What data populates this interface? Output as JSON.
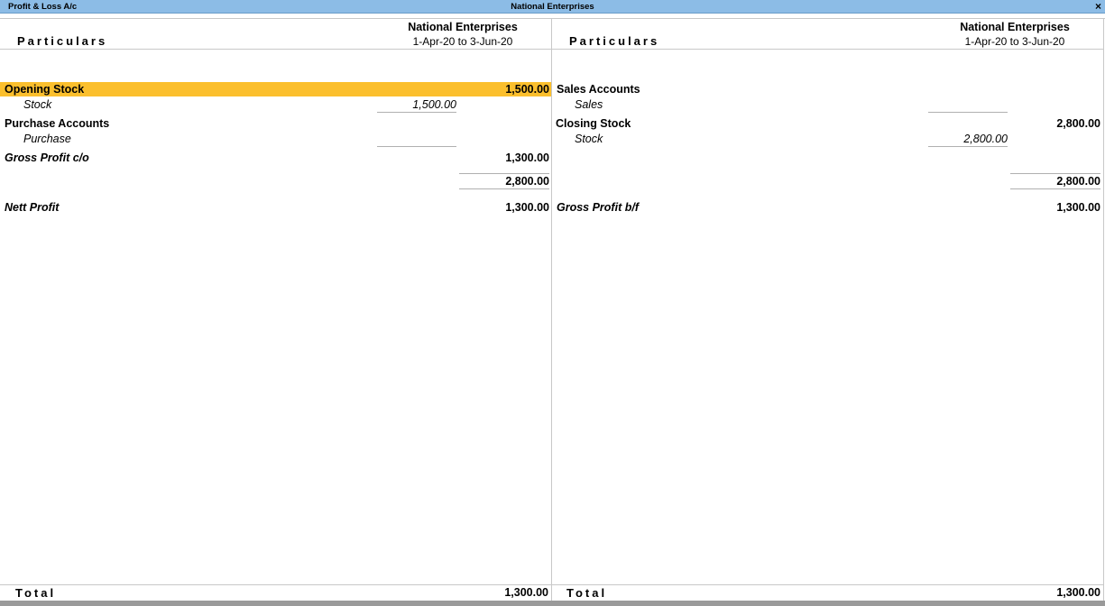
{
  "window": {
    "title": "Profit & Loss A/c",
    "company_title": "National Enterprises",
    "close_label": "×"
  },
  "columns": {
    "particulars": "Particulars",
    "company": "National Enterprises",
    "period": "1-Apr-20 to 3-Jun-20"
  },
  "left": {
    "opening_stock": {
      "label": "Opening Stock",
      "amount": "1,500.00"
    },
    "opening_stock_item": {
      "label": "Stock",
      "amount": "1,500.00"
    },
    "purchase_accounts": {
      "label": "Purchase Accounts"
    },
    "purchase_item": {
      "label": "Purchase"
    },
    "gross_profit_co": {
      "label": "Gross Profit c/o",
      "amount": "1,300.00"
    },
    "subtotal": "2,800.00",
    "nett_profit": {
      "label": "Nett Profit",
      "amount": "1,300.00"
    },
    "total": {
      "label": "Total",
      "amount": "1,300.00"
    }
  },
  "right": {
    "sales_accounts": {
      "label": "Sales Accounts"
    },
    "sales_item": {
      "label": "Sales"
    },
    "closing_stock": {
      "label": "Closing Stock",
      "amount": "2,800.00"
    },
    "closing_stock_item": {
      "label": "Stock",
      "amount": "2,800.00"
    },
    "subtotal": "2,800.00",
    "gross_profit_bf": {
      "label": "Gross Profit b/f",
      "amount": "1,300.00"
    },
    "total": {
      "label": "Total",
      "amount": "1,300.00"
    }
  },
  "colors": {
    "titlebar": "#8cbce6",
    "highlight": "#fbbf2d"
  }
}
